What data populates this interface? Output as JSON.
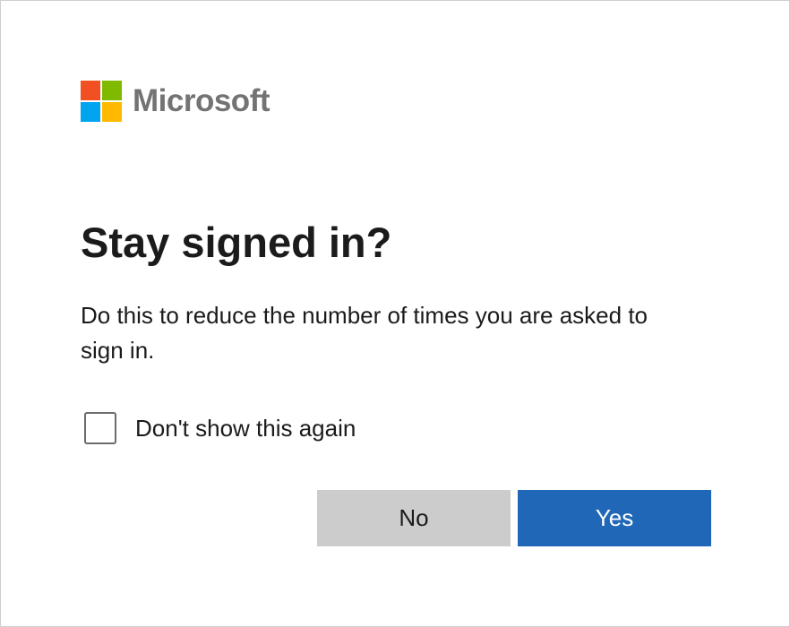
{
  "logo": {
    "text": "Microsoft",
    "colors": {
      "red": "#f25022",
      "green": "#7fba00",
      "blue": "#00a4ef",
      "yellow": "#ffb900"
    }
  },
  "dialog": {
    "title": "Stay signed in?",
    "description": "Do this to reduce the number of times you are asked to sign in.",
    "checkbox": {
      "label": "Don't show this again",
      "checked": false
    },
    "buttons": {
      "no_label": "No",
      "yes_label": "Yes"
    }
  },
  "colors": {
    "primary_button": "#2067b8",
    "secondary_button": "#cccccc",
    "text": "#1b1b1b"
  }
}
